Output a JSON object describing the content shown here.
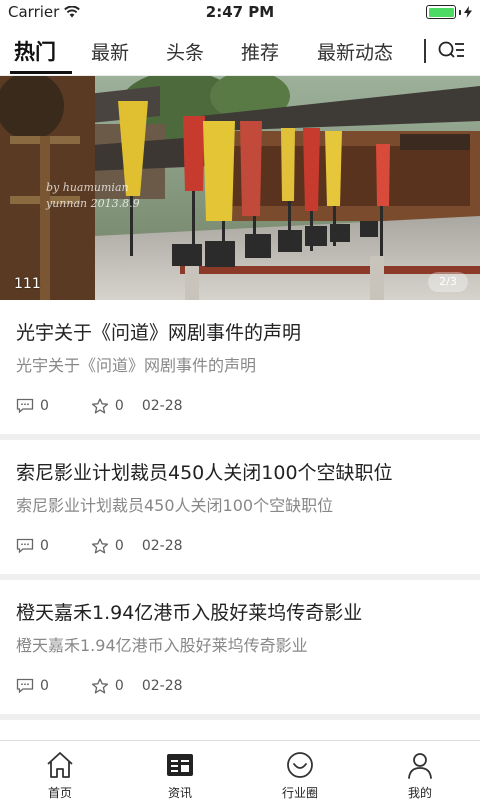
{
  "status_bar": {
    "carrier": "Carrier",
    "time": "2:47 PM",
    "battery_level": 1.0,
    "battery_color": "#4cd964"
  },
  "tabs": [
    {
      "label": "热门",
      "active": true
    },
    {
      "label": "最新",
      "active": false
    },
    {
      "label": "头条",
      "active": false
    },
    {
      "label": "推荐",
      "active": false
    },
    {
      "label": "最新动态",
      "active": false
    }
  ],
  "header_menu_icon": "list-search-icon",
  "banner": {
    "caption": "111",
    "pager": "2/3",
    "watermark_line1": "by huamumian",
    "watermark_line2": "yunnan 2013.8.9"
  },
  "news": [
    {
      "title": "光宇关于《问道》网剧事件的声明",
      "summary": "光宇关于《问道》网剧事件的声明",
      "comments": "0",
      "likes": "0",
      "date": "02-28"
    },
    {
      "title": "索尼影业计划裁员450人关闭100个空缺职位",
      "summary": "索尼影业计划裁员450人关闭100个空缺职位",
      "comments": "0",
      "likes": "0",
      "date": "02-28"
    },
    {
      "title": "橙天嘉禾1.94亿港币入股好莱坞传奇影业",
      "summary": "橙天嘉禾1.94亿港币入股好莱坞传奇影业",
      "comments": "0",
      "likes": "0",
      "date": "02-28"
    }
  ],
  "bottom_nav": [
    {
      "label": "首页",
      "icon": "home-icon"
    },
    {
      "label": "资讯",
      "icon": "news-icon"
    },
    {
      "label": "行业圈",
      "icon": "smile-circle-icon"
    },
    {
      "label": "我的",
      "icon": "user-icon"
    }
  ]
}
